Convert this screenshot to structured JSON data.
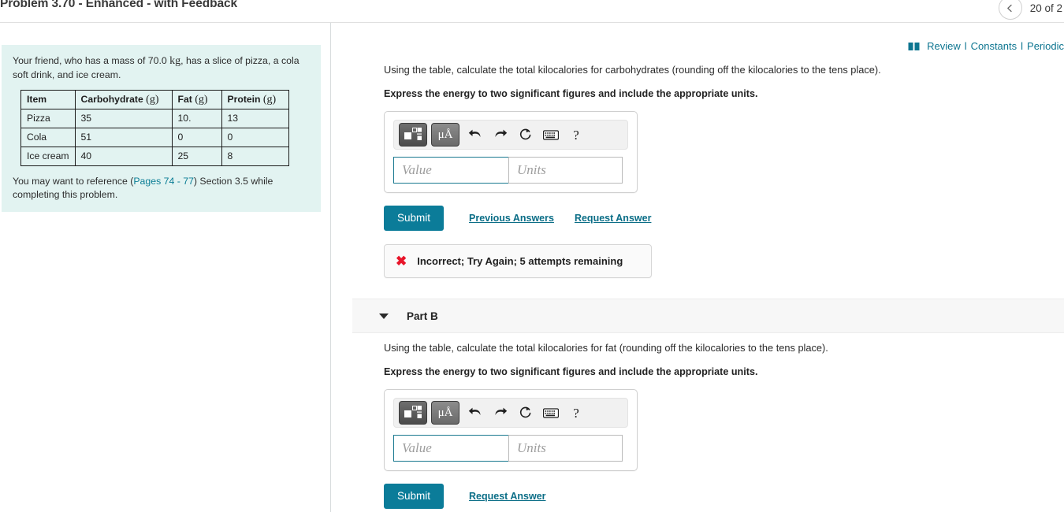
{
  "header": {
    "title": "Problem 3.70 - Enhanced - with Feedback",
    "page_counter": "20 of 2",
    "prev_icon": "chevron-left-icon"
  },
  "left_panel": {
    "intro_before": "Your friend, who has a mass of 70.0 ",
    "intro_unit": "kg",
    "intro_after": ", has a slice of pizza, a cola soft drink, and ice cream.",
    "table": {
      "headers": [
        "Item",
        "Carbohydrate",
        "Fat",
        "Protein"
      ],
      "header_units": [
        "",
        "(g)",
        "(g)",
        "(g)"
      ],
      "rows": [
        [
          "Pizza",
          "35",
          "10.",
          "13"
        ],
        [
          "Cola",
          "51",
          "0",
          "0"
        ],
        [
          "Ice cream",
          "40",
          "25",
          "8"
        ]
      ]
    },
    "reference_before": "You may want to reference (",
    "reference_link": "Pages 74 - 77",
    "reference_after": ") Section 3.5 while completing this problem."
  },
  "top_links": {
    "book_icon": "book-icon",
    "review": "Review",
    "separator": "l",
    "constants": "Constants",
    "periodic": "Periodic"
  },
  "answer_widget": {
    "template_button_icon": "math-template-icon",
    "units_button_label": "μÅ",
    "undo_icon": "undo-arrow-icon",
    "redo_icon": "redo-arrow-icon",
    "reset_icon": "reset-circle-icon",
    "keyboard_icon": "keyboard-icon",
    "help_label": "?",
    "value_placeholder": "Value",
    "units_placeholder": "Units",
    "value_text": "",
    "units_text": ""
  },
  "part_a": {
    "question": "Using the table, calculate the total kilocalories for carbohydrates (rounding off the kilocalories to the tens place).",
    "instruction": "Express the energy to two significant figures and include the appropriate units.",
    "submit_label": "Submit",
    "previous_answers_label": "Previous Answers",
    "request_answer_label": "Request Answer",
    "feedback_icon": "x-mark-icon",
    "feedback_text": "Incorrect; Try Again; 5 attempts remaining"
  },
  "part_b": {
    "header_label": "Part B",
    "caret_icon": "caret-down-icon",
    "question": "Using the table, calculate the total kilocalories for fat (rounding off the kilocalories to the tens place).",
    "instruction": "Express the energy to two significant figures and include the appropriate units.",
    "submit_label": "Submit",
    "request_answer_label": "Request Answer"
  },
  "colors": {
    "accent_teal": "#0b7c99",
    "panel_cyan": "#e2f3f1",
    "error_red": "#e8152a",
    "link_teal": "#0a7d95"
  }
}
